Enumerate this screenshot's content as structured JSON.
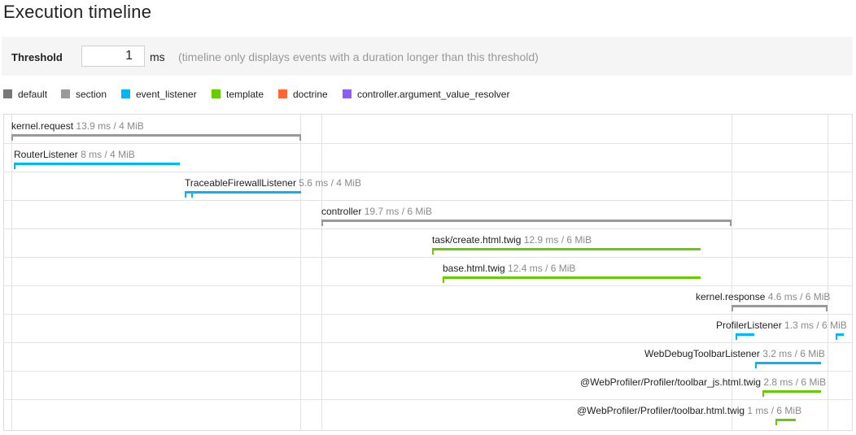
{
  "page": {
    "title": "Execution timeline"
  },
  "threshold": {
    "label": "Threshold",
    "value": "1",
    "unit": "ms",
    "help": "(timeline only displays events with a duration longer than this threshold)"
  },
  "colors": {
    "default": "#777777",
    "section": "#999999",
    "event_listener": "#00b8f5",
    "template": "#66cc00",
    "doctrine": "#ff6633",
    "controller.argument_value_resolver": "#8b5cf6"
  },
  "legend": [
    {
      "label": "default",
      "color": "#777777"
    },
    {
      "label": "section",
      "color": "#999999"
    },
    {
      "label": "event_listener",
      "color": "#00b8f5"
    },
    {
      "label": "template",
      "color": "#66cc00"
    },
    {
      "label": "doctrine",
      "color": "#ff6633"
    },
    {
      "label": "controller.argument_value_resolver",
      "color": "#8b5cf6"
    }
  ],
  "events": [
    {
      "name": "kernel.request",
      "meta": "13.9 ms / 4 MiB",
      "category": "section"
    },
    {
      "name": "RouterListener",
      "meta": "8 ms / 4 MiB",
      "category": "event_listener"
    },
    {
      "name": "TraceableFirewallListener",
      "meta": "5.6 ms / 4 MiB",
      "category": "event_listener"
    },
    {
      "name": "controller",
      "meta": "19.7 ms / 6 MiB",
      "category": "section"
    },
    {
      "name": "task/create.html.twig",
      "meta": "12.9 ms / 6 MiB",
      "category": "template"
    },
    {
      "name": "base.html.twig",
      "meta": "12.4 ms / 6 MiB",
      "category": "template"
    },
    {
      "name": "kernel.response",
      "meta": "4.6 ms / 6 MiB",
      "category": "section"
    },
    {
      "name": "ProfilerListener",
      "meta": "1.3 ms / 6 MiB",
      "category": "event_listener"
    },
    {
      "name": "WebDebugToolbarListener",
      "meta": "3.2 ms / 6 MiB",
      "category": "event_listener"
    },
    {
      "name": "@WebProfiler/Profiler/toolbar_js.html.twig",
      "meta": "2.8 ms / 6 MiB",
      "category": "template"
    },
    {
      "name": "@WebProfiler/Profiler/toolbar.html.twig",
      "meta": "1 ms / 6 MiB",
      "category": "template"
    }
  ]
}
